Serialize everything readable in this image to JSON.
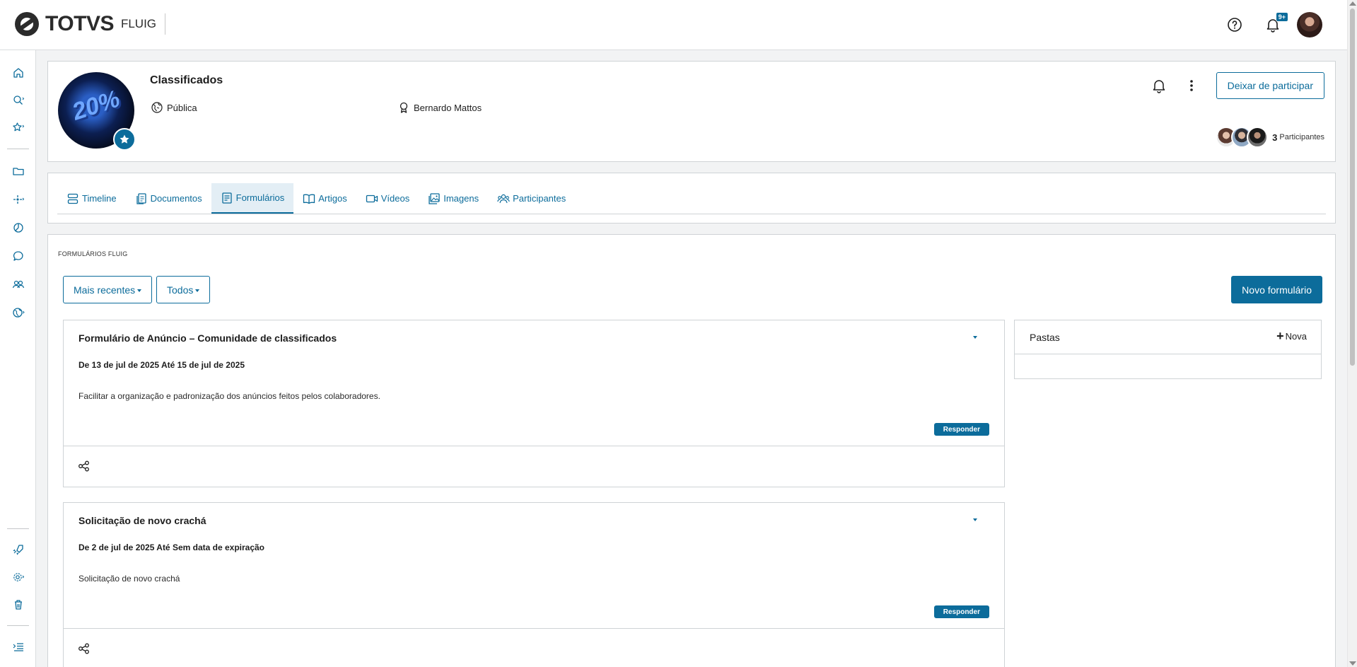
{
  "header": {
    "logo_text": "TOTVS",
    "logo_sub": "FLUIG",
    "notification_badge": "9+",
    "icons": [
      "help-icon",
      "bell-icon",
      "user-avatar"
    ]
  },
  "sidebar": {
    "icons": [
      "home-icon",
      "search-icon",
      "star-icon",
      "folder-icon",
      "process-icon",
      "analytics-icon",
      "chat-icon",
      "communities-icon",
      "globe-icon",
      "rocket-icon",
      "gear-icon",
      "trash-icon",
      "collapse-menu-icon"
    ]
  },
  "community": {
    "name": "Classificados",
    "privacy": "Pública",
    "owner": "Bernardo Mattos",
    "avatar_text": "20%",
    "leave_label": "Deixar de participar",
    "participants_count": "3",
    "participants_label": "Participantes"
  },
  "tabs": [
    {
      "label": "Timeline",
      "icon": "timeline-icon"
    },
    {
      "label": "Documentos",
      "icon": "documents-icon"
    },
    {
      "label": "Formulários",
      "icon": "forms-icon",
      "active": true
    },
    {
      "label": "Artigos",
      "icon": "book-icon"
    },
    {
      "label": "Vídeos",
      "icon": "video-icon"
    },
    {
      "label": "Imagens",
      "icon": "image-icon"
    },
    {
      "label": "Participantes",
      "icon": "participants-icon"
    }
  ],
  "forms_section": {
    "label": "FORMULÁRIOS FLUIG",
    "sort_label": "Mais recentes",
    "filter_label": "Todos",
    "new_form_label": "Novo formulário",
    "respond_label": "Responder",
    "items": [
      {
        "title": "Formulário de Anúncio – Comunidade de classificados",
        "dates": "De 13 de jul de 2025 Até 15 de jul de 2025",
        "description": "Facilitar a organização e padronização dos anúncios feitos pelos colaboradores."
      },
      {
        "title": "Solicitação de novo crachá",
        "dates": "De 2 de jul de 2025 Até Sem data de expiração",
        "description": "Solicitação de novo crachá"
      }
    ]
  },
  "folders": {
    "title": "Pastas",
    "new_label": "Nova"
  },
  "colors": {
    "accent": "#0c6c9b",
    "active_tab_bg": "#e3eef5",
    "border": "#cfd3d6",
    "page_bg": "#f2f3f4"
  }
}
